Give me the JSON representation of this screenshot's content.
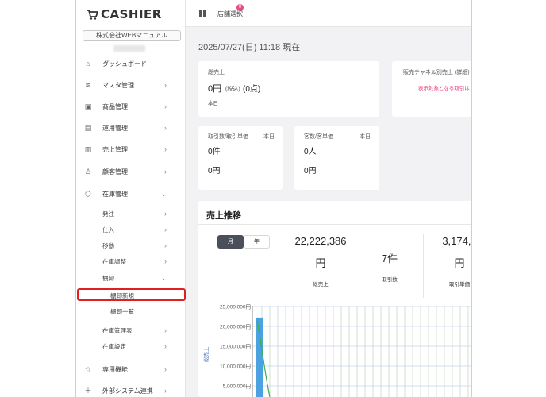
{
  "app": {
    "logo_text": "CASHIER",
    "company": "株式会社WEBマニュアル"
  },
  "topbar": {
    "store_select": "店舗選択",
    "badge": "0"
  },
  "datetime": "2025/07/27(日) 11:18 現在",
  "sidebar": {
    "items": [
      {
        "label": "ダッシュボード",
        "icon": "home-icon"
      },
      {
        "label": "マスタ管理",
        "icon": "database-icon"
      },
      {
        "label": "商品管理",
        "icon": "gift-icon"
      },
      {
        "label": "運用管理",
        "icon": "document-icon"
      },
      {
        "label": "売上管理",
        "icon": "bar-chart-icon"
      },
      {
        "label": "顧客管理",
        "icon": "user-icon"
      },
      {
        "label": "在庫管理",
        "icon": "box-icon"
      }
    ],
    "stock_sub": [
      "発注",
      "仕入",
      "移動",
      "在庫調整",
      "棚卸"
    ],
    "inventory_sub": [
      "棚卸新規",
      "棚卸一覧"
    ],
    "stock_sub2": [
      "在庫管理表",
      "在庫設定"
    ],
    "bottom": [
      {
        "label": "専用機能",
        "icon": "star-icon"
      },
      {
        "label": "外部システム連携",
        "icon": "plus-icon"
      }
    ]
  },
  "cards": {
    "sales": {
      "title": "総売上",
      "value": "0円",
      "tax": "(税込)",
      "count": "(0点)",
      "period": "本日"
    },
    "channel": {
      "title": "販売チャネル別売上 (詳細)",
      "note": "表示対象となる取引は"
    },
    "transactions": {
      "title": "取引数/取引単価",
      "period": "本日",
      "count": "0件",
      "unit": "0円"
    },
    "customers": {
      "title": "客数/客単価",
      "period": "本日",
      "count": "0人",
      "unit": "0円"
    }
  },
  "sales_trend": {
    "title": "売上推移",
    "btn_month": "月",
    "btn_year": "年",
    "stats": [
      {
        "value": "22,222,386",
        "unit": "円",
        "label": "総売上"
      },
      {
        "value": "7件",
        "unit": "",
        "label": "取引数"
      },
      {
        "value": "3,174,6",
        "unit": "円",
        "label": "取引単価"
      }
    ]
  },
  "chart_data": {
    "type": "bar",
    "ylabel": "総売上",
    "yticks": [
      "25,000,000円",
      "20,000,000円",
      "15,000,000円",
      "10,000,000円",
      "5,000,000円"
    ],
    "ylim": [
      0,
      25000000
    ],
    "values": [
      22222386
    ],
    "colors": {
      "bar": "#4aa3e0",
      "line": "#3cb043",
      "grid_h": "#d6dcf0",
      "grid_v": "#c8d8c8"
    }
  }
}
